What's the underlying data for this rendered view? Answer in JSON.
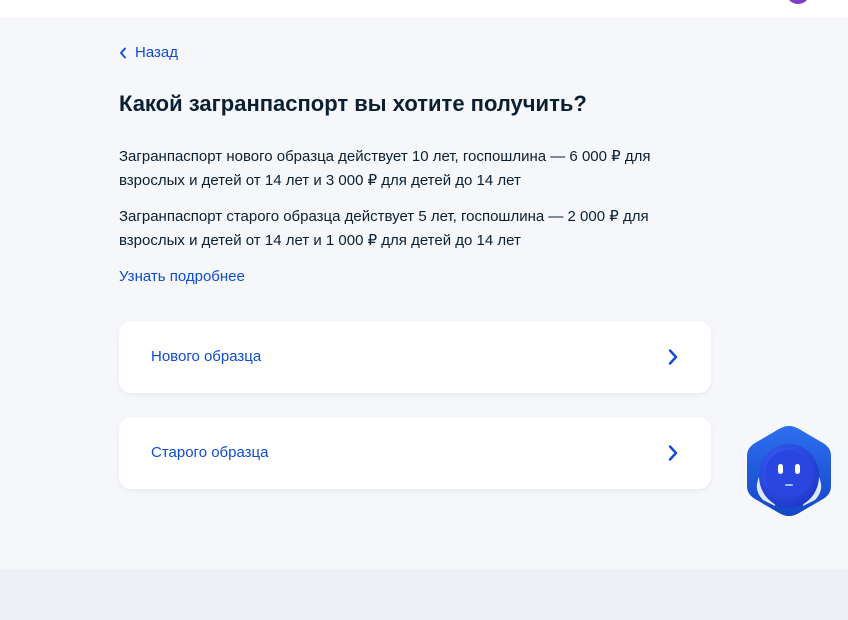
{
  "nav": {
    "back_label": "Назад"
  },
  "page": {
    "title": "Какой загранпаспорт вы хотите получить?",
    "info_new": "Загранпаспорт нового образца действует 10 лет, госпошлина — 6 000 ₽ для взрослых и детей от 14 лет и 3 000 ₽ для детей до 14 лет",
    "info_old": "Загранпаспорт старого образца действует 5 лет, госпошлина — 2 000 ₽ для взрослых и детей от 14 лет и 1 000 ₽ для детей до 14 лет",
    "more_link": "Узнать подробнее"
  },
  "options": [
    {
      "label": "Нового образца",
      "icon": "chevron-right-icon"
    },
    {
      "label": "Старого образца",
      "icon": "chevron-right-icon"
    }
  ],
  "assistant": {
    "icon": "robot-assistant-icon"
  },
  "colors": {
    "accent": "#0d4cd3",
    "text": "#0b1f33",
    "background": "#f5f7fa",
    "card": "#ffffff",
    "footer": "#edf1f5"
  }
}
